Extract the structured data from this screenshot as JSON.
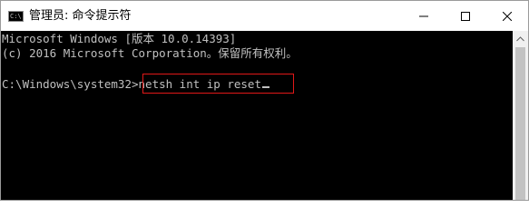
{
  "window": {
    "title": "管理员: 命令提示符",
    "icon": "console-icon",
    "icon_text": "C:\\",
    "controls": {
      "minimize": "minimize-icon",
      "maximize": "maximize-icon",
      "close": "close-icon"
    }
  },
  "console": {
    "lines": [
      "Microsoft Windows [版本 10.0.14393]",
      "(c) 2016 Microsoft Corporation。保留所有权利。"
    ],
    "prompt": "C:\\Windows\\system32>",
    "command": "netsh int ip reset",
    "text_color": "#c0c0c0",
    "background": "#000000",
    "highlight_color": "#e01818"
  }
}
